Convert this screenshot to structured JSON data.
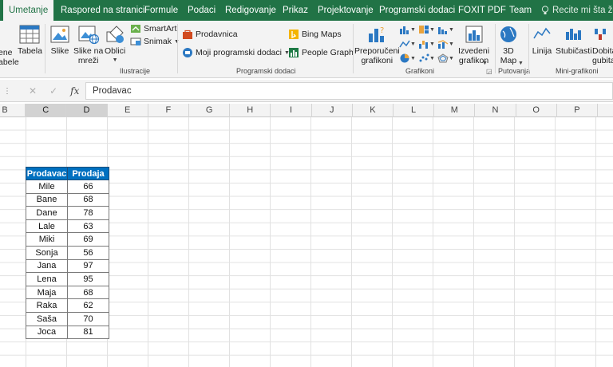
{
  "tabs": [
    {
      "label": "Umetanje",
      "active": true
    },
    {
      "label": "Raspored na stranici"
    },
    {
      "label": "Formule"
    },
    {
      "label": "Podaci"
    },
    {
      "label": "Redigovanje"
    },
    {
      "label": "Prikaz"
    },
    {
      "label": "Projektovanje"
    },
    {
      "label": "Programski dodaci"
    },
    {
      "label": "FOXIT PDF"
    },
    {
      "label": "Team"
    }
  ],
  "tell_me": "Recite mi šta želite",
  "ribbon": {
    "tables": {
      "pivot_partial": "ene\nabele",
      "table": "Tabela"
    },
    "illustrations": {
      "label": "Ilustracije",
      "pictures": "Slike",
      "online_pictures": "Slike na\nmreži",
      "shapes": "Oblici",
      "smartart": "SmartArt",
      "screenshot": "Snimak"
    },
    "addins": {
      "label": "Programski dodaci",
      "store": "Prodavnica",
      "my_addins": "Moji programski dodaci",
      "bing_maps": "Bing Maps",
      "people_graph": "People Graph"
    },
    "charts": {
      "label": "Grafikoni",
      "recommended": "Preporučeni\ngrafikoni",
      "pivot_chart": "Izvedeni\ngrafikon"
    },
    "tours": {
      "label": "Putovanja",
      "map3d": "3D\nMap"
    },
    "sparklines": {
      "label": "Mini-grafikoni",
      "line": "Linija",
      "column": "Stubičasti",
      "winloss_partial": "Dobitak\ngubitak"
    }
  },
  "formula_bar": {
    "value": "Prodavac"
  },
  "columns": [
    "B",
    "C",
    "D",
    "E",
    "F",
    "G",
    "H",
    "I",
    "J",
    "K",
    "L",
    "M",
    "N",
    "O",
    "P"
  ],
  "selected_columns": [
    "C",
    "D"
  ],
  "table": {
    "headers": [
      "Prodavac",
      "Prodaja"
    ],
    "rows": [
      [
        "Mile",
        "66"
      ],
      [
        "Bane",
        "68"
      ],
      [
        "Dane",
        "78"
      ],
      [
        "Lale",
        "63"
      ],
      [
        "Miki",
        "69"
      ],
      [
        "Sonja",
        "56"
      ],
      [
        "Jana",
        "97"
      ],
      [
        "Lena",
        "95"
      ],
      [
        "Maja",
        "68"
      ],
      [
        "Raka",
        "62"
      ],
      [
        "Saša",
        "70"
      ],
      [
        "Joca",
        "81"
      ]
    ]
  },
  "colors": {
    "accent": "#217346",
    "table_header": "#0070c0"
  }
}
